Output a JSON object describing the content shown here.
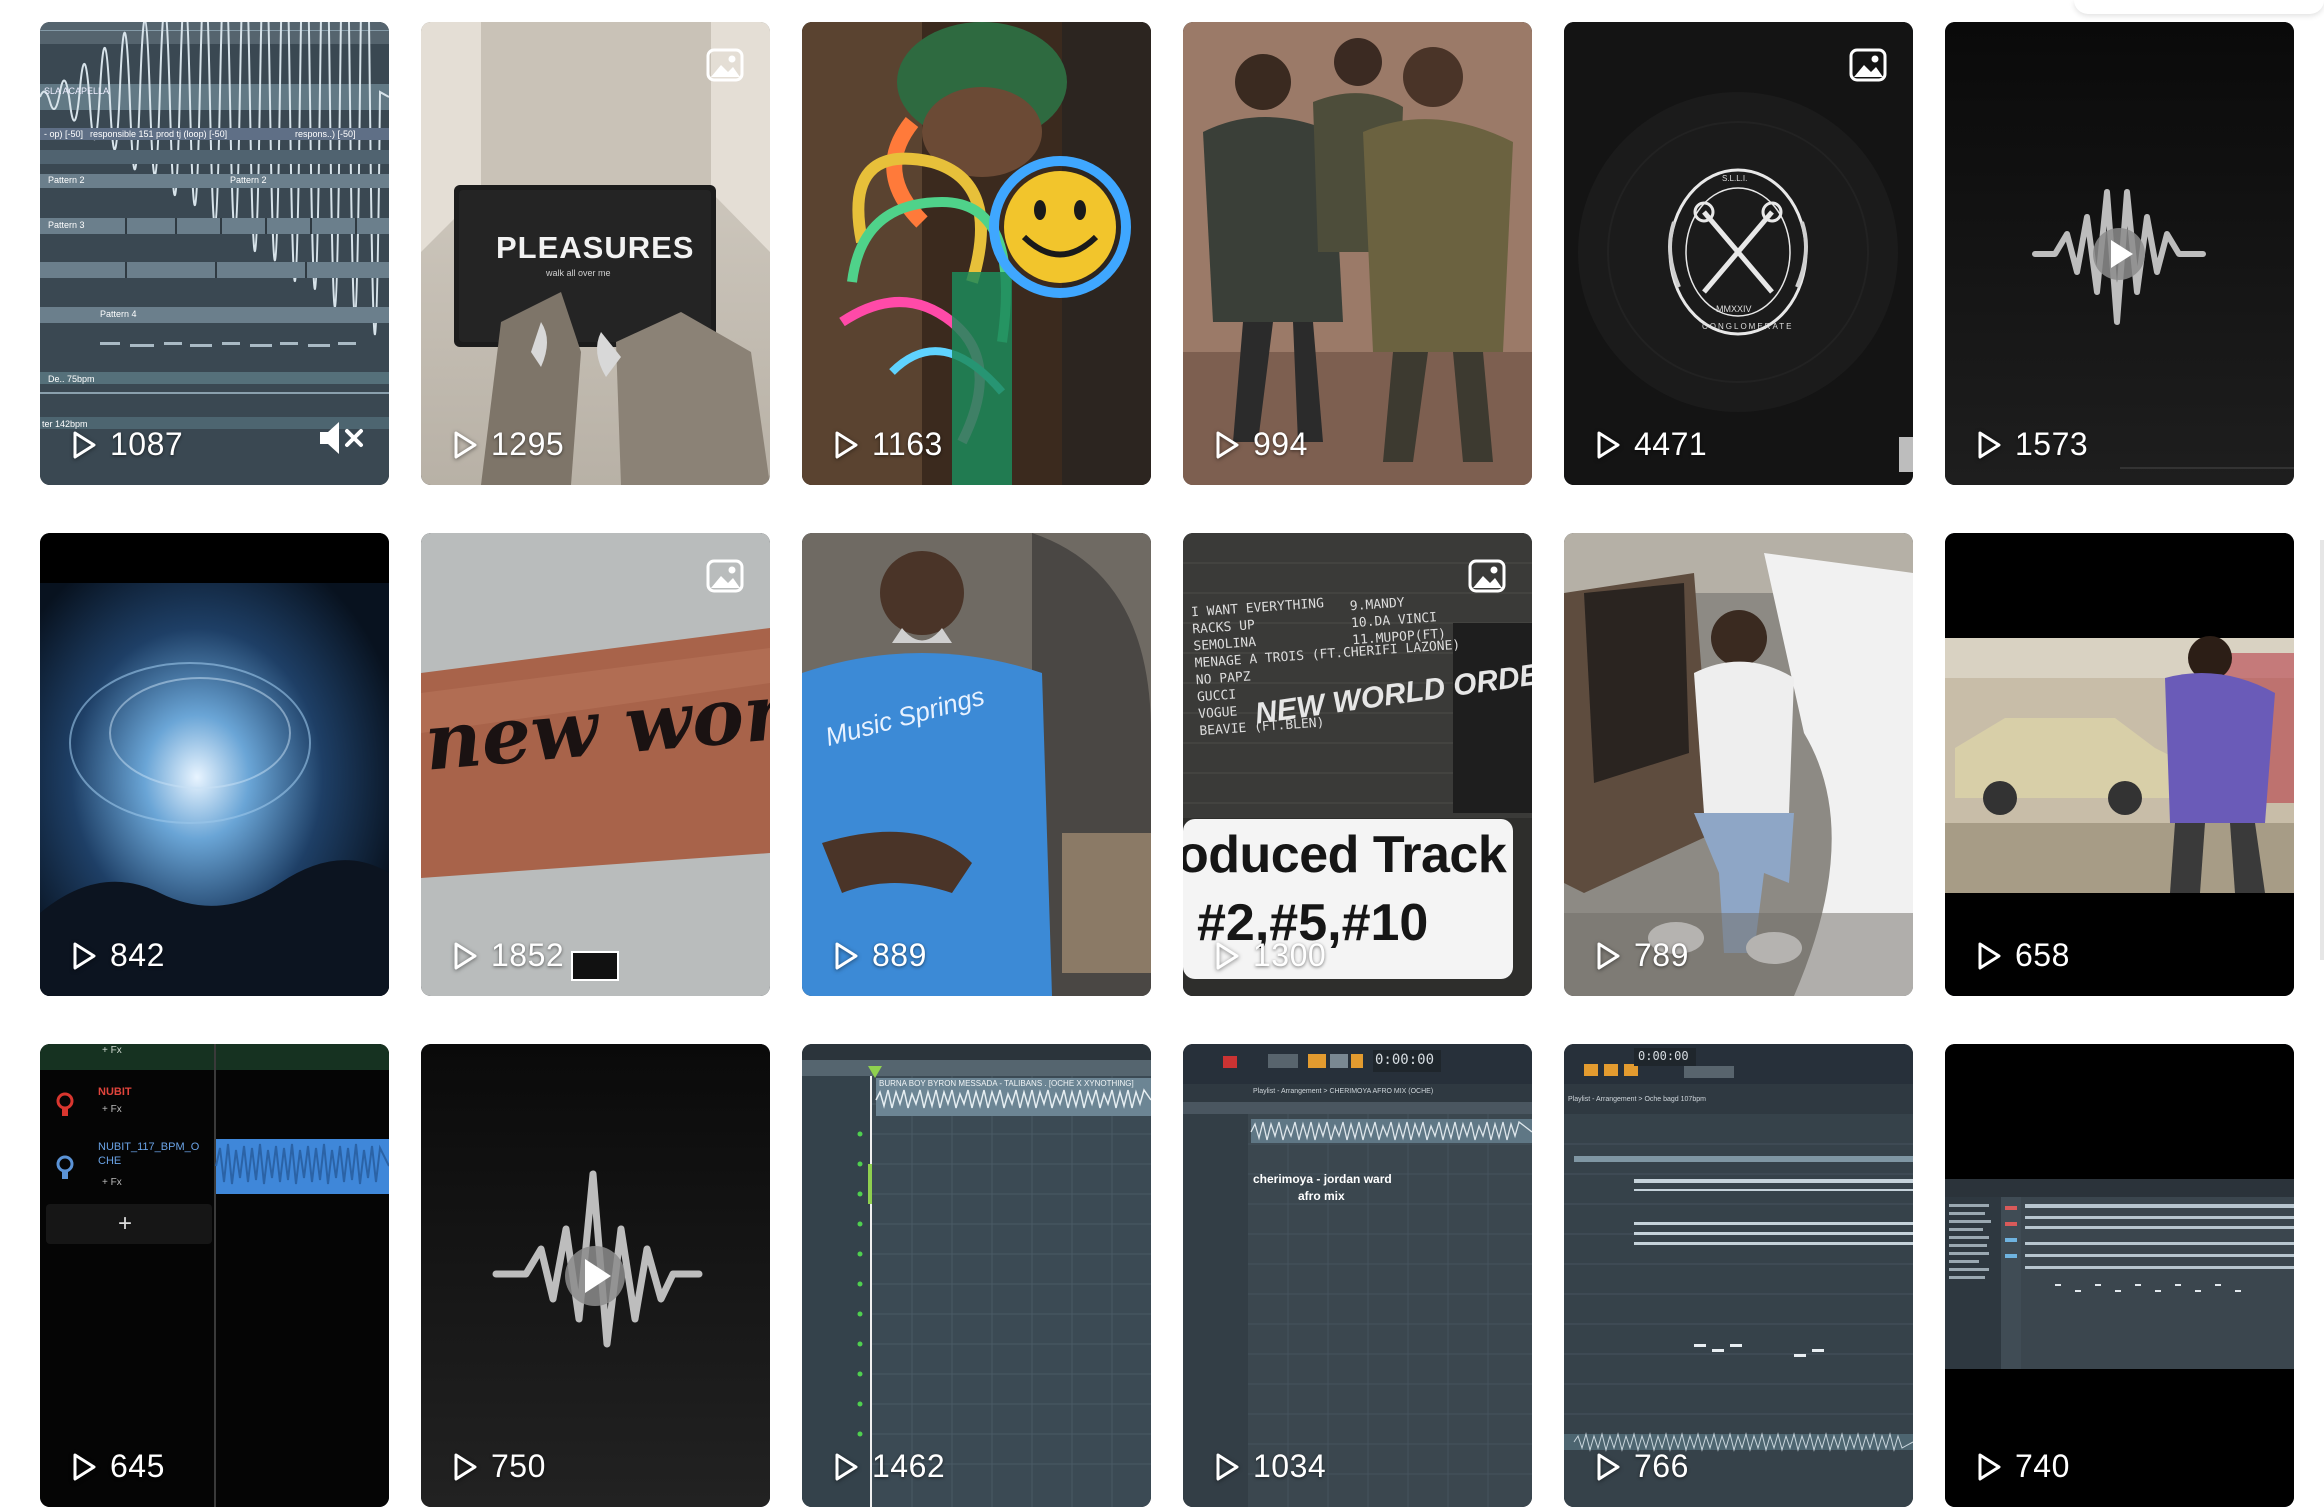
{
  "grid": {
    "tiles": [
      {
        "views": "1087",
        "label": "SLA ACAPELLA",
        "clip1": "- op) [-50]",
        "clip2": "responsible 151 prod tj (loop) [-50]",
        "clip3": "respons..) [-50]",
        "pattern2": "Pattern 2",
        "pattern3": "Pattern 3",
        "pattern4": "Pattern 4",
        "tempo": "De.. 75bpm",
        "tempo2": "ter 142bpm"
      },
      {
        "views": "1295",
        "mat_title": "PLEASURES",
        "mat_sub": "walk all over me"
      },
      {
        "views": "1163"
      },
      {
        "views": "994"
      },
      {
        "views": "4471",
        "seal_top": "S.L.L.I.",
        "seal_year": "MMXXIV",
        "seal_bottom": "CONGLOMERATE"
      },
      {
        "views": "1573"
      },
      {
        "views": "842"
      },
      {
        "views": "1852",
        "tattoo": "new world order"
      },
      {
        "views": "889",
        "shirt": "Music Springs"
      },
      {
        "views": "1300",
        "caption_line1": "oduced Track",
        "caption_line2": "#2,#5,#10",
        "wall_lines": [
          "I WANT EVERYTHING",
          "RACKS UP",
          "SEMOLINA",
          "MENAGE A TROIS (FT.CHERIFI LAZONE)",
          "NO PAPZ",
          "GUCCI",
          "VOGUE",
          "BEAVIE (FT.BLEN)",
          "9.MANDY",
          "10.DA VINCI",
          "11.MUPOP(FT)"
        ],
        "graffiti": "NEW WORLD ORDER!!!"
      },
      {
        "views": "789"
      },
      {
        "views": "658"
      },
      {
        "views": "645",
        "fx": "+ Fx",
        "track1": "NUBIT",
        "track2": "NUBIT_117_BPM_O CHE",
        "add": "+"
      },
      {
        "views": "750"
      },
      {
        "views": "1462",
        "clip_title": "BURNA BOY BYRON MESSADA - TALIBANS . [OCHE X XYNOTHING]"
      },
      {
        "views": "1034",
        "caption": "cherimoya - jordan ward",
        "caption2": "afro mix",
        "time": "0:00:00",
        "playlist": "Playlist - Arrangement > CHERIMOYA AFRO MIX (OCHE)"
      },
      {
        "views": "766",
        "time": "0:00:00",
        "playlist": "Playlist - Arrangement > Oche  bagd 107bpm"
      },
      {
        "views": "740"
      }
    ]
  },
  "colors": {
    "play_icon": "#ffffff",
    "daw_bg": "#36424b",
    "daw_clip": "#5b7483",
    "accent_orange": "#e39b2f"
  },
  "icons": {
    "views": "play-outline-icon",
    "photo": "photo-badge-icon",
    "mute": "muted-speaker-icon",
    "audio": "audio-waveform-icon"
  }
}
